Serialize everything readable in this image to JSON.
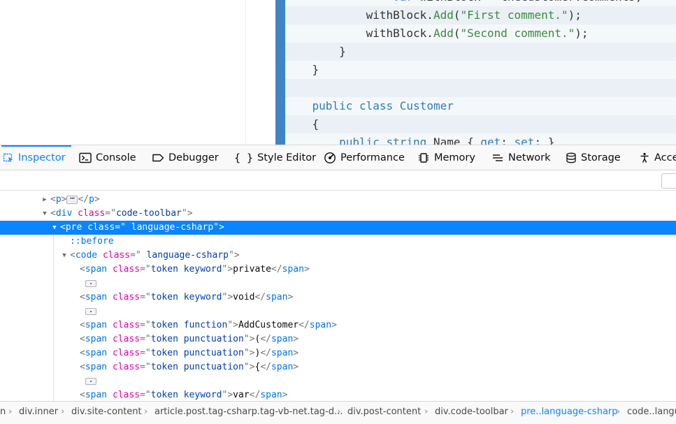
{
  "code_view": {
    "lines": [
      [
        {
          "t": "                ",
          "c": "pl"
        },
        {
          "t": "var",
          "c": "kw"
        },
        {
          "t": " withBlock = theCustomer.Comments;",
          "c": "pl"
        }
      ],
      [
        {
          "t": "            ",
          "c": "pl"
        },
        {
          "t": "withBlock",
          "c": "pl"
        },
        {
          "t": ".",
          "c": "pl"
        },
        {
          "t": "Add",
          "c": "fn"
        },
        {
          "t": "(",
          "c": "pl"
        },
        {
          "t": "\"First comment.\"",
          "c": "str"
        },
        {
          "t": ");",
          "c": "pl"
        }
      ],
      [
        {
          "t": "            ",
          "c": "pl"
        },
        {
          "t": "withBlock",
          "c": "pl"
        },
        {
          "t": ".",
          "c": "pl"
        },
        {
          "t": "Add",
          "c": "fn"
        },
        {
          "t": "(",
          "c": "pl"
        },
        {
          "t": "\"Second comment.\"",
          "c": "str"
        },
        {
          "t": ");",
          "c": "pl"
        }
      ],
      [
        {
          "t": "        }",
          "c": "pl"
        }
      ],
      [
        {
          "t": "    }",
          "c": "pl"
        }
      ],
      [
        {
          "t": "",
          "c": "pl"
        }
      ],
      [
        {
          "t": "    ",
          "c": "pl"
        },
        {
          "t": "public",
          "c": "kw"
        },
        {
          "t": " ",
          "c": "pl"
        },
        {
          "t": "class",
          "c": "kw"
        },
        {
          "t": " ",
          "c": "pl"
        },
        {
          "t": "Customer",
          "c": "kw"
        }
      ],
      [
        {
          "t": "    {",
          "c": "pl"
        }
      ],
      [
        {
          "t": "        ",
          "c": "pl"
        },
        {
          "t": "public",
          "c": "kw"
        },
        {
          "t": " ",
          "c": "pl"
        },
        {
          "t": "string",
          "c": "kw"
        },
        {
          "t": " Name { ",
          "c": "pl"
        },
        {
          "t": "get",
          "c": "kw"
        },
        {
          "t": "; ",
          "c": "pl"
        },
        {
          "t": "set",
          "c": "kw"
        },
        {
          "t": "; }",
          "c": "pl"
        }
      ]
    ]
  },
  "toolbar": {
    "tabs": [
      {
        "label": "Inspector",
        "icon": "inspector-icon",
        "active": true
      },
      {
        "label": "Console",
        "icon": "console-icon",
        "active": false
      },
      {
        "label": "Debugger",
        "icon": "debugger-icon",
        "active": false
      },
      {
        "label": "Style Editor",
        "icon": "style-editor-icon",
        "active": false
      },
      {
        "label": "Performance",
        "icon": "performance-icon",
        "active": false
      },
      {
        "label": "Memory",
        "icon": "memory-icon",
        "active": false
      },
      {
        "label": "Network",
        "icon": "network-icon",
        "active": false
      },
      {
        "label": "Storage",
        "icon": "storage-icon",
        "active": false
      },
      {
        "label": "Acce",
        "icon": "accessibility-icon",
        "active": false
      }
    ]
  },
  "markup_tree": {
    "rows": [
      {
        "kind": "tag",
        "twisty": "collapsed",
        "tag": "p",
        "attrs": [],
        "collapsed_children": true
      },
      {
        "kind": "tag",
        "twisty": "expanded",
        "tag": "div",
        "attrs": [
          {
            "n": "class",
            "v": "code-toolbar"
          }
        ]
      },
      {
        "kind": "tag",
        "twisty": "expanded",
        "tag": "pre",
        "attrs": [
          {
            "n": "class",
            "v": " language-csharp"
          }
        ],
        "selected": true
      },
      {
        "kind": "pseudo",
        "text": "::before"
      },
      {
        "kind": "tag",
        "twisty": "expanded",
        "tag": "code",
        "attrs": [
          {
            "n": "class",
            "v": " language-csharp"
          }
        ]
      },
      {
        "kind": "tag",
        "tag": "span",
        "attrs": [
          {
            "n": "class",
            "v": "token keyword"
          }
        ],
        "text": "private",
        "close": true
      },
      {
        "kind": "whitespace"
      },
      {
        "kind": "tag",
        "tag": "span",
        "attrs": [
          {
            "n": "class",
            "v": "token keyword"
          }
        ],
        "text": "void",
        "close": true
      },
      {
        "kind": "whitespace"
      },
      {
        "kind": "tag",
        "tag": "span",
        "attrs": [
          {
            "n": "class",
            "v": "token function"
          }
        ],
        "text": "AddCustomer",
        "close": true
      },
      {
        "kind": "tag",
        "tag": "span",
        "attrs": [
          {
            "n": "class",
            "v": "token punctuation"
          }
        ],
        "text": "(",
        "close": true
      },
      {
        "kind": "tag",
        "tag": "span",
        "attrs": [
          {
            "n": "class",
            "v": "token punctuation"
          }
        ],
        "text": ")",
        "close": true
      },
      {
        "kind": "tag",
        "tag": "span",
        "attrs": [
          {
            "n": "class",
            "v": "token punctuation"
          }
        ],
        "text": "{",
        "close": true
      },
      {
        "kind": "whitespace"
      },
      {
        "kind": "tag",
        "tag": "span",
        "attrs": [
          {
            "n": "class",
            "v": "token keyword"
          }
        ],
        "text": "var",
        "close": true
      }
    ]
  },
  "breadcrumbs": [
    {
      "label": "n",
      "selected": false
    },
    {
      "label": "div.inner",
      "selected": false
    },
    {
      "label": "div.site-content",
      "selected": false
    },
    {
      "label": "article.post.tag-csharp.tag-vb-net.tag-d...",
      "selected": false
    },
    {
      "label": "div.post-content",
      "selected": false
    },
    {
      "label": "div.code-toolbar",
      "selected": false
    },
    {
      "label": "pre..language-csharp",
      "selected": true
    },
    {
      "label": "code..langu",
      "selected": false
    }
  ],
  "colors": {
    "accent": "#0a84ff",
    "code_accent": "#3f85c6",
    "tag": "#0074e8",
    "attribute": "#dd00a9",
    "attribute_value": "#003eaa"
  }
}
